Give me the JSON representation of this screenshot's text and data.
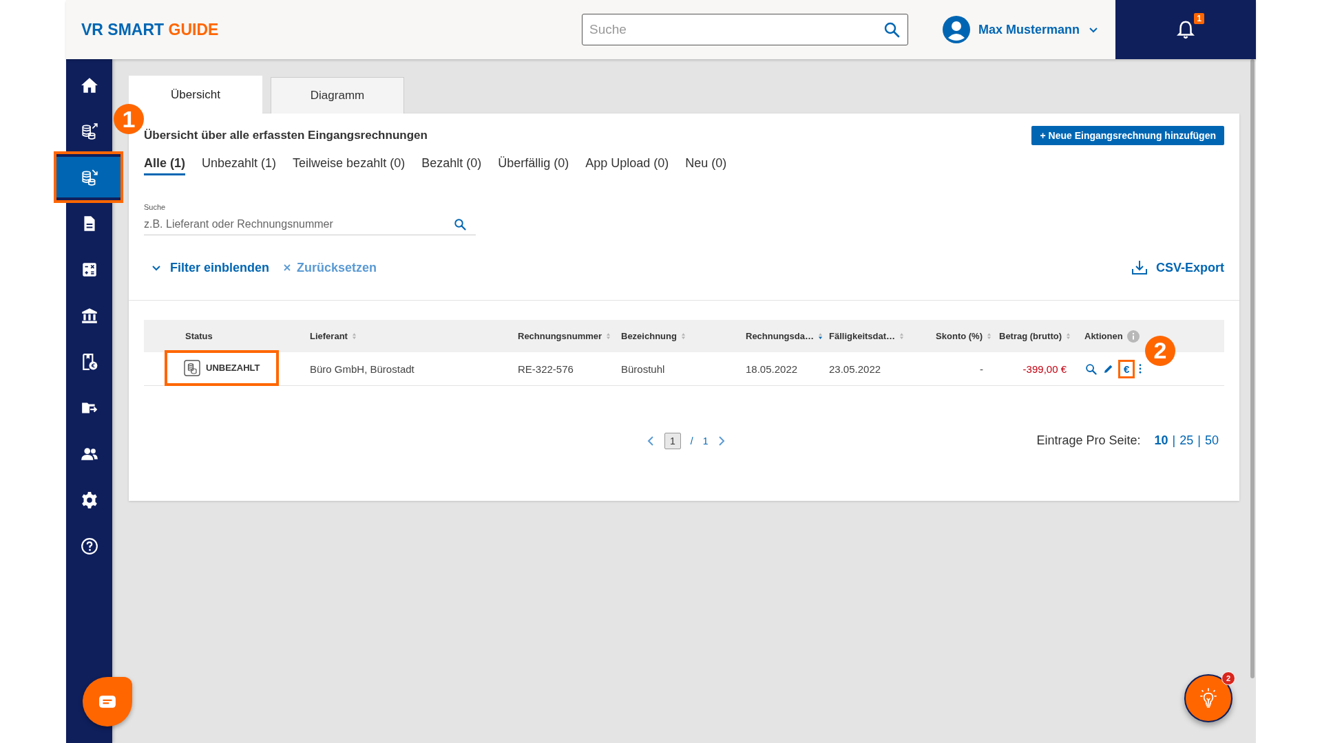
{
  "header": {
    "logo_main": "VR SMART",
    "logo_accent": "GUIDE",
    "search": {
      "placeholder": "Suche"
    },
    "user": "Max Mustermann",
    "notification_count": "1"
  },
  "sidebar": {
    "items": [
      {
        "kind": "home",
        "selected": false,
        "highlighted": false
      },
      {
        "kind": "coins-out",
        "selected": false,
        "highlighted": false
      },
      {
        "kind": "coins-in",
        "selected": true,
        "highlighted": true
      },
      {
        "kind": "document",
        "selected": false,
        "highlighted": false
      },
      {
        "kind": "calculator",
        "selected": false,
        "highlighted": false
      },
      {
        "kind": "bank",
        "selected": false,
        "highlighted": false
      },
      {
        "kind": "receipt",
        "selected": false,
        "highlighted": false
      },
      {
        "kind": "folder",
        "selected": false,
        "highlighted": false
      },
      {
        "kind": "people",
        "selected": false,
        "highlighted": false
      },
      {
        "kind": "settings",
        "selected": false,
        "highlighted": false
      },
      {
        "kind": "help",
        "selected": false,
        "highlighted": false
      }
    ]
  },
  "annotations": [
    {
      "label": "1"
    },
    {
      "label": "2"
    }
  ],
  "page_tabs": [
    {
      "label": "Übersicht",
      "selected": true
    },
    {
      "label": "Diagramm",
      "selected": false
    }
  ],
  "title": "Übersicht über alle erfassten Eingangsrechnungen",
  "add_button": "+ Neue Eingangsrechnung hinzufügen",
  "filter_tabs": [
    {
      "label": "Alle (1)",
      "selected": true
    },
    {
      "label": "Unbezahlt (1)",
      "selected": false
    },
    {
      "label": "Teilweise bezahlt (0)",
      "selected": false
    },
    {
      "label": "Bezahlt (0)",
      "selected": false
    },
    {
      "label": "Überfällig (0)",
      "selected": false
    },
    {
      "label": "App Upload (0)",
      "selected": false
    },
    {
      "label": "Neu (0)",
      "selected": false
    }
  ],
  "search": {
    "label": "Suche",
    "placeholder": "z.B. Lieferant oder Rechnungsnummer"
  },
  "filter_toggle": "Filter einblenden",
  "reset": "Zurücksetzen",
  "csv_export": "CSV-Export",
  "table": {
    "columns": [
      {
        "label": "Status",
        "kind": "plain"
      },
      {
        "label": "Lieferant",
        "kind": "sortable"
      },
      {
        "label": "Rechnungsnummer",
        "kind": "sortable"
      },
      {
        "label": "Bezeichnung",
        "kind": "sortable"
      },
      {
        "label": "Rechnungsda…",
        "kind": "sorted-desc"
      },
      {
        "label": "Fälligkeitsdat…",
        "kind": "sortable"
      },
      {
        "label": "Skonto (%)",
        "kind": "sortable"
      },
      {
        "label": "Betrag (brutto)",
        "kind": "sortable"
      },
      {
        "label": "Aktionen",
        "kind": "info"
      }
    ],
    "rows": [
      {
        "status": "UNBEZAHLT",
        "status_highlighted": true,
        "supplier": "Büro GmbH, Bürostadt",
        "number": "RE-322-576",
        "description": "Bürostuhl",
        "invoice_date": "18.05.2022",
        "due_date": "23.05.2022",
        "discount": "-",
        "amount": "-399,00 €",
        "amount_negative": true,
        "actions": [
          {
            "kind": "search",
            "highlighted": false
          },
          {
            "kind": "edit",
            "highlighted": false
          },
          {
            "kind": "pay",
            "label": "€",
            "highlighted": true
          },
          {
            "kind": "more",
            "highlighted": false
          }
        ]
      }
    ]
  },
  "pagination": {
    "current": "1",
    "separator": "/",
    "total": "1"
  },
  "per_page": {
    "label": "Eintrage Pro Seite:",
    "separator": "|",
    "options": [
      {
        "label": "10",
        "selected": true
      },
      {
        "label": "25",
        "selected": false
      },
      {
        "label": "50",
        "selected": false
      }
    ]
  },
  "help_badge": "2"
}
